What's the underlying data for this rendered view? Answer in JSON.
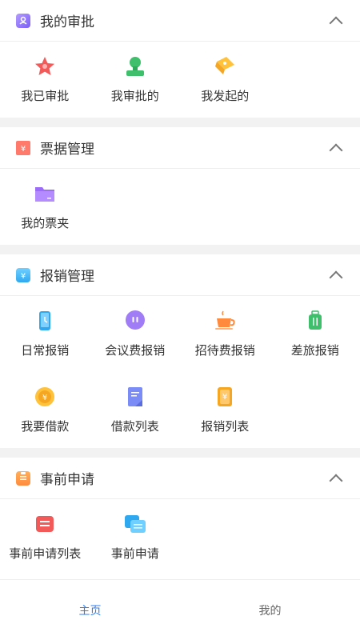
{
  "sections": [
    {
      "title": "我的审批",
      "icon": "approval-icon",
      "items": [
        {
          "label": "我已审批",
          "icon": "star-icon"
        },
        {
          "label": "我审批的",
          "icon": "stamp-icon"
        },
        {
          "label": "我发起的",
          "icon": "flag-icon"
        }
      ]
    },
    {
      "title": "票据管理",
      "icon": "ticket-icon",
      "items": [
        {
          "label": "我的票夹",
          "icon": "folder-icon"
        }
      ]
    },
    {
      "title": "报销管理",
      "icon": "expense-icon",
      "items": [
        {
          "label": "日常报销",
          "icon": "phone-icon"
        },
        {
          "label": "会议费报销",
          "icon": "chat-icon"
        },
        {
          "label": "招待费报销",
          "icon": "coffee-icon"
        },
        {
          "label": "差旅报销",
          "icon": "luggage-icon"
        },
        {
          "label": "我要借款",
          "icon": "coin-icon"
        },
        {
          "label": "借款列表",
          "icon": "document-icon"
        },
        {
          "label": "报销列表",
          "icon": "receipt-icon"
        }
      ]
    },
    {
      "title": "事前申请",
      "icon": "clipboard-icon",
      "items": [
        {
          "label": "事前申请列表",
          "icon": "list-icon"
        },
        {
          "label": "事前申请",
          "icon": "message-icon"
        }
      ]
    }
  ],
  "tabbar": {
    "home": "主页",
    "mine": "我的"
  },
  "colors": {
    "accent": "#2b7cf6"
  }
}
